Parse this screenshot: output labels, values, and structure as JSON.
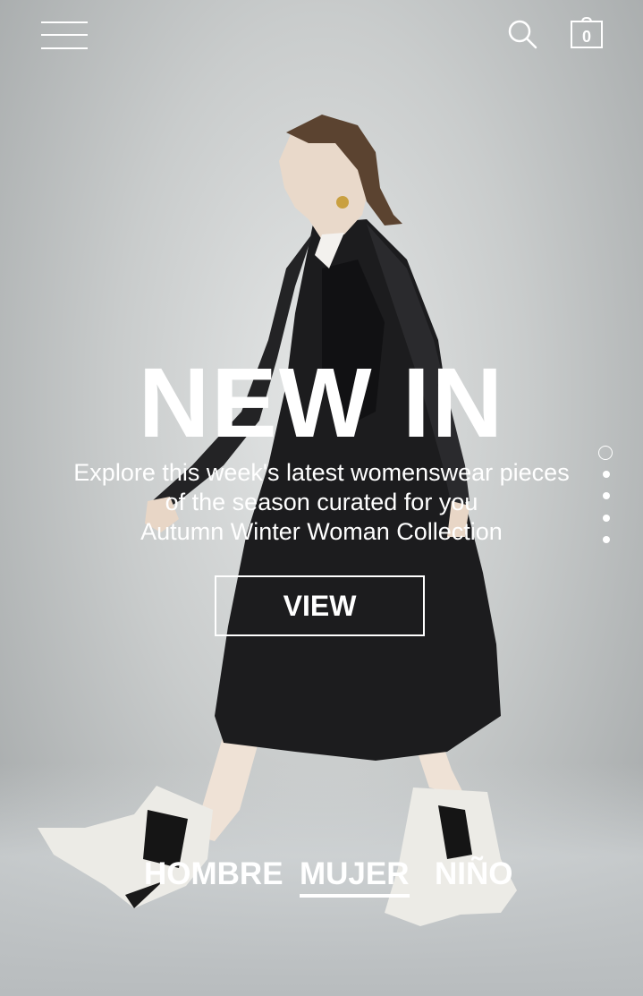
{
  "header": {
    "menu_icon": "hamburger-menu-icon",
    "search_icon": "search-icon",
    "cart_icon": "shopping-bag-icon",
    "cart_count": "0"
  },
  "hero": {
    "title": "NEW IN",
    "subtitle_lines": [
      "Explore this week's latest womenswear pieces",
      "of the season curated for you",
      "Autumn Winter Woman Collection"
    ],
    "cta_label": "VIEW"
  },
  "slider": {
    "slide_count": 5,
    "active_index": 0
  },
  "gender_nav": {
    "items": [
      {
        "label": "HOMBRE",
        "active": false
      },
      {
        "label": "MUJER",
        "active": true
      },
      {
        "label": "NIÑO",
        "active": false
      }
    ]
  },
  "colors": {
    "text": "#ffffff",
    "background": "#c9cccc",
    "coat": "#1c1c1e"
  }
}
